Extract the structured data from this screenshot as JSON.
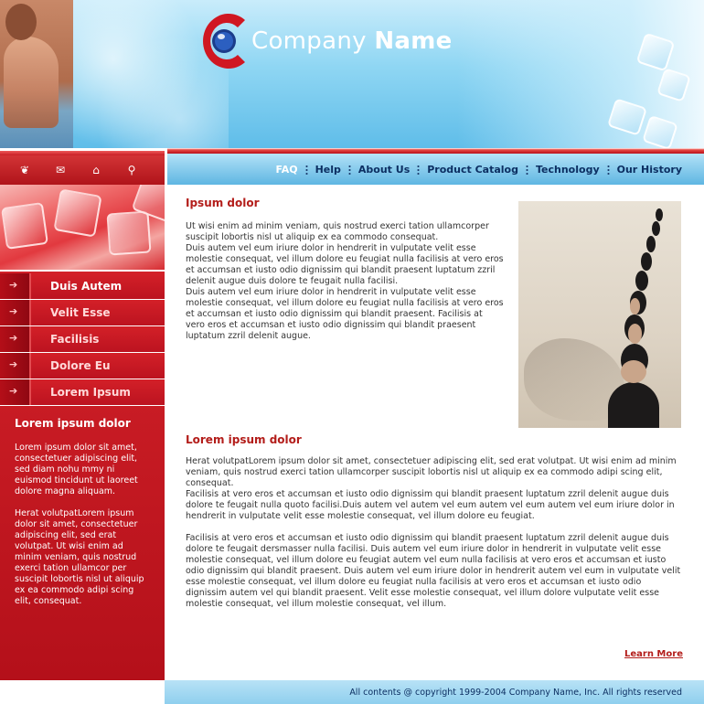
{
  "brand": {
    "name_light": "Company",
    "name_bold": "Name"
  },
  "icon_nav": [
    {
      "name": "home-alt-icon",
      "glyph": "⌂"
    },
    {
      "name": "mail-icon",
      "glyph": "✉"
    },
    {
      "name": "home-icon",
      "glyph": "⌂"
    },
    {
      "name": "search-icon",
      "glyph": "⌕"
    }
  ],
  "top_nav": [
    "FAQ",
    "Help",
    "About Us",
    "Product Catalog",
    "Technology",
    "Our History"
  ],
  "sidebar": {
    "menu": [
      "Duis Autem",
      "Velit Esse",
      "Facilisis",
      "Dolore Eu",
      "Lorem Ipsum"
    ],
    "title": "Lorem ipsum dolor",
    "para1": "Lorem ipsum dolor sit amet, consectetuer adipiscing elit, sed diam nohu mmy ni euismod tincidunt ut laoreet dolore magna aliquam.",
    "para2": "Herat volutpatLorem ipsum dolor sit amet, consectetuer adipiscing elit, sed erat volutpat. Ut wisi enim ad minim veniam, quis nostrud exerci tation ullamcor per suscipit lobortis nisl ut aliquip ex ea commodo adipi scing elit, consequat."
  },
  "main": {
    "section1_title": "Ipsum dolor",
    "section1_text": "Ut wisi enim ad minim veniam, quis nostrud exerci tation ullamcorper suscipit lobortis nisl ut aliquip ex ea commodo consequat.\nDuis autem vel eum iriure dolor in hendrerit in vulputate velit esse molestie consequat, vel illum dolore eu feugiat nulla facilisis at vero eros et accumsan et iusto odio dignissim qui blandit praesent luptatum zzril delenit augue duis dolore te feugait nulla facilisi.\nDuis autem vel eum iriure dolor in hendrerit in vulputate velit esse molestie consequat, vel illum dolore eu feugiat nulla facilisis at vero eros et accumsan et iusto odio dignissim qui blandit praesent. Facilisis at vero eros et accumsan et iusto odio dignissim qui blandit praesent luptatum zzril delenit augue.",
    "section2_title": "Lorem ipsum dolor",
    "section2_para1": "Herat volutpatLorem ipsum dolor sit amet, consectetuer adipiscing elit, sed erat volutpat. Ut wisi enim ad minim veniam, quis nostrud exerci tation ullamcorper suscipit lobortis nisl ut aliquip ex ea commodo adipi scing elit, consequat.\nFacilisis at vero eros et accumsan et iusto odio dignissim qui blandit praesent luptatum zzril delenit augue duis dolore te feugait nulla quoto facilisi.Duis autem vel autem vel eum autem vel eum autem vel eum iriure dolor in hendrerit in vulputate velit esse molestie consequat, vel illum dolore eu feugiat.",
    "section2_para2": "Facilisis at vero eros et accumsan et iusto odio dignissim qui blandit praesent luptatum zzril delenit augue duis dolore te feugait dersmasser nulla facilisi. Duis autem vel eum iriure dolor in hendrerit in vulputate velit esse molestie consequat, vel illum dolore eu feugiat autem vel eum nulla facilisis at vero eros et accumsan et iusto odio dignissim qui blandit praesent. Duis autem vel eum iriure dolor in hendrerit autem vel eum in vulputate velit esse molestie consequat, vel illum dolore eu feugiat nulla facilisis at vero eros et accumsan et iusto odio dignissim autem vel qui blandit praesent. Velit esse molestie consequat, vel illum dolore vulputate velit esse molestie consequat, vel illum molestie consequat, vel illum.",
    "learn_more": "Learn More"
  },
  "footer": {
    "copyright": "All contents @ copyright 1999-2004 Company Name, Inc. All rights reserved"
  },
  "colors": {
    "accent_red": "#b31d1a",
    "nav_blue": "#0c2f62",
    "sidebar_red": "#c8161f",
    "sky_blue": "#8fd6f3"
  }
}
